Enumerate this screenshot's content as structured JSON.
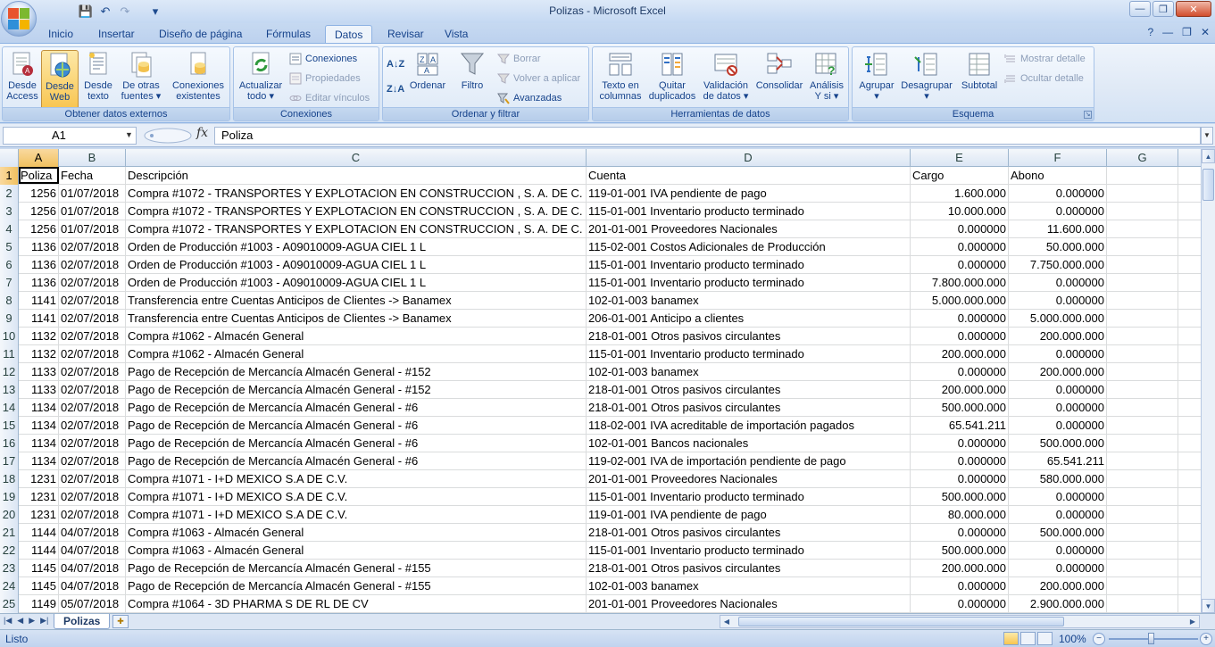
{
  "window": {
    "title": "Polizas - Microsoft Excel",
    "min": "—",
    "max": "❐",
    "close": "✕"
  },
  "qat": {
    "save": "💾",
    "undo": "↶",
    "redo": "↷",
    "more": "▾"
  },
  "tabs": [
    "Inicio",
    "Insertar",
    "Diseño de página",
    "Fórmulas",
    "Datos",
    "Revisar",
    "Vista"
  ],
  "active_tab": "Datos",
  "ribbon": {
    "obtener": {
      "label": "Obtener datos externos",
      "desde_access": [
        "Desde",
        "Access"
      ],
      "desde_web": [
        "Desde",
        "Web"
      ],
      "desde_texto": [
        "Desde",
        "texto"
      ],
      "otras_fuentes": [
        "De otras",
        "fuentes ▾"
      ],
      "conexiones_existentes": [
        "Conexiones",
        "existentes"
      ]
    },
    "conexiones": {
      "label": "Conexiones",
      "actualizar": [
        "Actualizar",
        "todo ▾"
      ],
      "conexiones": "Conexiones",
      "propiedades": "Propiedades",
      "editar_vinculos": "Editar vínculos"
    },
    "ordenar": {
      "label": "Ordenar y filtrar",
      "az": "A↓Z",
      "za": "Z↓A",
      "ordenar": "Ordenar",
      "filtro": "Filtro",
      "borrar": "Borrar",
      "volver": "Volver a aplicar",
      "avanzadas": "Avanzadas"
    },
    "herramientas": {
      "label": "Herramientas de datos",
      "texto_columnas": [
        "Texto en",
        "columnas"
      ],
      "quitar_duplicados": [
        "Quitar",
        "duplicados"
      ],
      "validacion": [
        "Validación",
        "de datos ▾"
      ],
      "consolidar": "Consolidar",
      "analisis": [
        "Análisis",
        "Y si ▾"
      ]
    },
    "esquema": {
      "label": "Esquema",
      "agrupar": [
        "Agrupar",
        "▾"
      ],
      "desagrupar": [
        "Desagrupar",
        "▾"
      ],
      "subtotal": "Subtotal",
      "mostrar_detalle": "Mostrar detalle",
      "ocultar_detalle": "Ocultar detalle"
    }
  },
  "formula_bar": {
    "name_box": "A1",
    "fx": "fx",
    "value": "Poliza"
  },
  "columns": [
    "A",
    "B",
    "C",
    "D",
    "E",
    "F",
    "G"
  ],
  "rows": [
    {
      "n": "1",
      "a": "Poliza",
      "b": "Fecha",
      "c": "Descripción",
      "d": "Cuenta",
      "e": "Cargo",
      "f": "Abono"
    },
    {
      "n": "2",
      "a": "1256",
      "b": "01/07/2018",
      "c": "Compra #1072 -  TRANSPORTES Y EXPLOTACION EN CONSTRUCCION , S. A. DE C. V.",
      "d": "119-01-001 IVA pendiente de pago",
      "e": "1.600.000",
      "f": "0.000000"
    },
    {
      "n": "3",
      "a": "1256",
      "b": "01/07/2018",
      "c": "Compra #1072 -  TRANSPORTES Y EXPLOTACION EN CONSTRUCCION , S. A. DE C. V.",
      "d": "115-01-001 Inventario producto terminado",
      "e": "10.000.000",
      "f": "0.000000"
    },
    {
      "n": "4",
      "a": "1256",
      "b": "01/07/2018",
      "c": "Compra #1072 -  TRANSPORTES Y EXPLOTACION EN CONSTRUCCION , S. A. DE C. V.",
      "d": "201-01-001 Proveedores Nacionales",
      "e": "0.000000",
      "f": "11.600.000"
    },
    {
      "n": "5",
      "a": "1136",
      "b": "02/07/2018",
      "c": "Orden de Producción #1003 - A09010009-AGUA CIEL 1 L",
      "d": "115-02-001 Costos Adicionales de Producción",
      "e": "0.000000",
      "f": "50.000.000"
    },
    {
      "n": "6",
      "a": "1136",
      "b": "02/07/2018",
      "c": "Orden de Producción #1003 - A09010009-AGUA CIEL 1 L",
      "d": "115-01-001 Inventario producto terminado",
      "e": "0.000000",
      "f": "7.750.000.000"
    },
    {
      "n": "7",
      "a": "1136",
      "b": "02/07/2018",
      "c": "Orden de Producción #1003 - A09010009-AGUA CIEL 1 L",
      "d": "115-01-001 Inventario producto terminado",
      "e": "7.800.000.000",
      "f": "0.000000"
    },
    {
      "n": "8",
      "a": "1141",
      "b": "02/07/2018",
      "c": "Transferencia entre Cuentas Anticipos de Clientes -> Banamex",
      "d": "102-01-003 banamex",
      "e": "5.000.000.000",
      "f": "0.000000"
    },
    {
      "n": "9",
      "a": "1141",
      "b": "02/07/2018",
      "c": "Transferencia entre Cuentas Anticipos de Clientes -> Banamex",
      "d": "206-01-001 Anticipo a clientes",
      "e": "0.000000",
      "f": "5.000.000.000"
    },
    {
      "n": "10",
      "a": "1132",
      "b": "02/07/2018",
      "c": "Compra #1062 - Almacén General",
      "d": "218-01-001 Otros pasivos circulantes",
      "e": "0.000000",
      "f": "200.000.000"
    },
    {
      "n": "11",
      "a": "1132",
      "b": "02/07/2018",
      "c": "Compra #1062 - Almacén General",
      "d": "115-01-001 Inventario producto terminado",
      "e": "200.000.000",
      "f": "0.000000"
    },
    {
      "n": "12",
      "a": "1133",
      "b": "02/07/2018",
      "c": "Pago de Recepción de Mercancía Almacén General - #152",
      "d": "102-01-003 banamex",
      "e": "0.000000",
      "f": "200.000.000"
    },
    {
      "n": "13",
      "a": "1133",
      "b": "02/07/2018",
      "c": "Pago de Recepción de Mercancía Almacén General - #152",
      "d": "218-01-001 Otros pasivos circulantes",
      "e": "200.000.000",
      "f": "0.000000"
    },
    {
      "n": "14",
      "a": "1134",
      "b": "02/07/2018",
      "c": "Pago de Recepción de Mercancía Almacén General - #6",
      "d": "218-01-001 Otros pasivos circulantes",
      "e": "500.000.000",
      "f": "0.000000"
    },
    {
      "n": "15",
      "a": "1134",
      "b": "02/07/2018",
      "c": "Pago de Recepción de Mercancía Almacén General - #6",
      "d": "118-02-001 IVA acreditable de importación pagados",
      "e": "65.541.211",
      "f": "0.000000"
    },
    {
      "n": "16",
      "a": "1134",
      "b": "02/07/2018",
      "c": "Pago de Recepción de Mercancía Almacén General - #6",
      "d": "102-01-001 Bancos nacionales",
      "e": "0.000000",
      "f": "500.000.000"
    },
    {
      "n": "17",
      "a": "1134",
      "b": "02/07/2018",
      "c": "Pago de Recepción de Mercancía Almacén General - #6",
      "d": "119-02-001 IVA de importación pendiente de pago",
      "e": "0.000000",
      "f": "65.541.211"
    },
    {
      "n": "18",
      "a": "1231",
      "b": "02/07/2018",
      "c": "Compra #1071 - I+D MEXICO S.A DE C.V.",
      "d": "201-01-001 Proveedores Nacionales",
      "e": "0.000000",
      "f": "580.000.000"
    },
    {
      "n": "19",
      "a": "1231",
      "b": "02/07/2018",
      "c": "Compra #1071 - I+D MEXICO S.A DE C.V.",
      "d": "115-01-001 Inventario producto terminado",
      "e": "500.000.000",
      "f": "0.000000"
    },
    {
      "n": "20",
      "a": "1231",
      "b": "02/07/2018",
      "c": "Compra #1071 - I+D MEXICO S.A DE C.V.",
      "d": "119-01-001 IVA pendiente de pago",
      "e": "80.000.000",
      "f": "0.000000"
    },
    {
      "n": "21",
      "a": "1144",
      "b": "04/07/2018",
      "c": "Compra #1063 - Almacén General",
      "d": "218-01-001 Otros pasivos circulantes",
      "e": "0.000000",
      "f": "500.000.000"
    },
    {
      "n": "22",
      "a": "1144",
      "b": "04/07/2018",
      "c": "Compra #1063 - Almacén General",
      "d": "115-01-001 Inventario producto terminado",
      "e": "500.000.000",
      "f": "0.000000"
    },
    {
      "n": "23",
      "a": "1145",
      "b": "04/07/2018",
      "c": "Pago de Recepción de Mercancía Almacén General - #155",
      "d": "218-01-001 Otros pasivos circulantes",
      "e": "200.000.000",
      "f": "0.000000"
    },
    {
      "n": "24",
      "a": "1145",
      "b": "04/07/2018",
      "c": "Pago de Recepción de Mercancía Almacén General - #155",
      "d": "102-01-003 banamex",
      "e": "0.000000",
      "f": "200.000.000"
    },
    {
      "n": "25",
      "a": "1149",
      "b": "05/07/2018",
      "c": "Compra #1064 - 3D PHARMA S DE RL DE CV",
      "d": "201-01-001 Proveedores Nacionales",
      "e": "0.000000",
      "f": "2.900.000.000"
    }
  ],
  "sheet": {
    "name": "Polizas",
    "nav": [
      "|◀",
      "◀",
      "▶",
      "▶|"
    ]
  },
  "status": {
    "text": "Listo",
    "zoom": "100%",
    "minus": "−",
    "plus": "+"
  },
  "colors": {
    "accent": "#15428b",
    "ribbon_bg": "#dfe9f6",
    "active_btn": "#f8c550",
    "header_sel": "#f1c15f"
  }
}
